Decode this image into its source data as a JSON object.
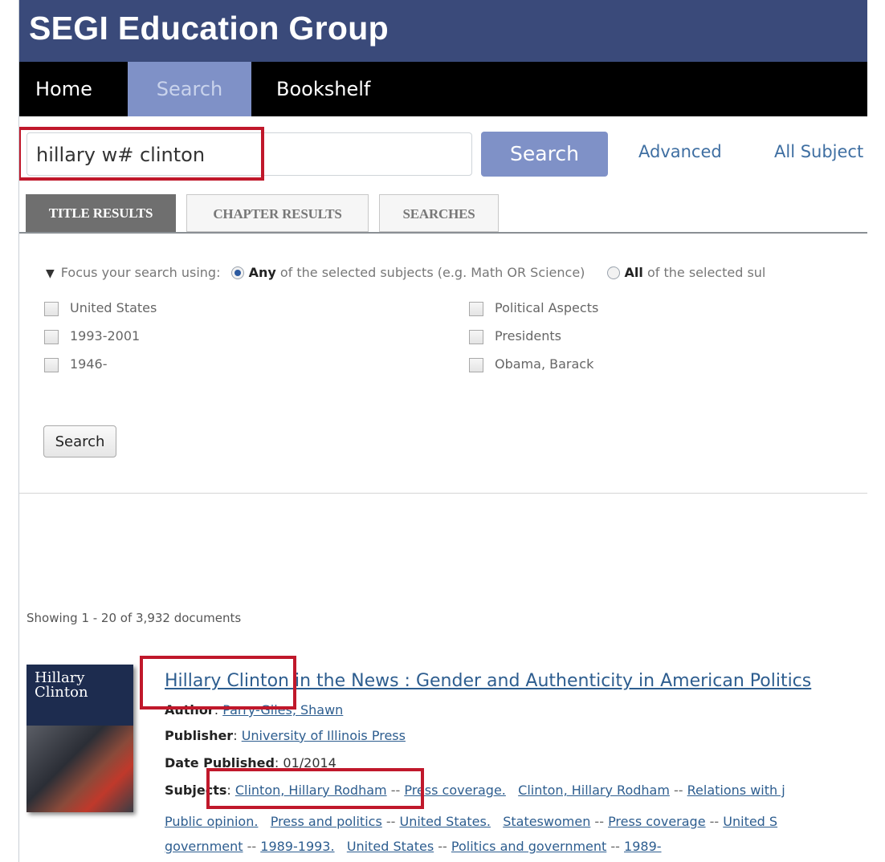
{
  "brand": {
    "title": "SEGI Education Group"
  },
  "nav": {
    "home": "Home",
    "search": "Search",
    "bookshelf": "Bookshelf"
  },
  "search": {
    "query": "hillary w# clinton",
    "button": "Search",
    "advanced": "Advanced",
    "all_subjects": "All Subject"
  },
  "tabs": [
    {
      "label": "TITLE RESULTS"
    },
    {
      "label": "CHAPTER RESULTS"
    },
    {
      "label": "SEARCHES"
    }
  ],
  "focus": {
    "prefix": "Focus your search using:",
    "any_bold": "Any",
    "any_text": "of the selected subjects (e.g. Math OR Science)",
    "all_bold": "All",
    "all_text": "of the selected sul"
  },
  "subjects": [
    {
      "label": "United States"
    },
    {
      "label": "1993-2001"
    },
    {
      "label": "1946-"
    },
    {
      "label": "Political Aspects"
    },
    {
      "label": "Presidents"
    },
    {
      "label": "Obama, Barack"
    }
  ],
  "facet_button": "Search",
  "results": {
    "showing": "Showing 1 - 20 of 3,932 documents",
    "item": {
      "cover_text": "Hillary Clinton",
      "title": "Hillary Clinton in the News : Gender and Authenticity in American Politics",
      "author_label": "Author",
      "author": "Parry-Giles, Shawn",
      "publisher_label": "Publisher",
      "publisher": "University of Illinois Press",
      "date_label": "Date Published",
      "date": "01/2014",
      "subjects_label": "Subjects",
      "subjects_line1": [
        {
          "text": "Clinton, Hillary Rodham"
        },
        {
          "sep": "--"
        },
        {
          "text": "Press coverage."
        },
        {
          "text": "Clinton, Hillary Rodham"
        },
        {
          "sep": "--"
        },
        {
          "text": "Relations with j"
        }
      ],
      "subjects_line2": [
        {
          "text": "Public opinion."
        },
        {
          "text": "Press and politics"
        },
        {
          "sep": "--"
        },
        {
          "text": "United States."
        },
        {
          "text": "Stateswomen"
        },
        {
          "sep": "--"
        },
        {
          "text": "Press coverage"
        },
        {
          "sep": "--"
        },
        {
          "text": "United S"
        }
      ],
      "subjects_line3": [
        {
          "text": "government"
        },
        {
          "sep": "--"
        },
        {
          "text": "1989-1993."
        },
        {
          "text": "United States"
        },
        {
          "sep": "--"
        },
        {
          "text": "Politics and government"
        },
        {
          "sep": "--"
        },
        {
          "text": "1989-"
        }
      ]
    }
  },
  "colors": {
    "brand": "#3a4a7a",
    "accent": "#7f91c7",
    "link": "#2d5d8f",
    "highlight": "#c0182b"
  }
}
